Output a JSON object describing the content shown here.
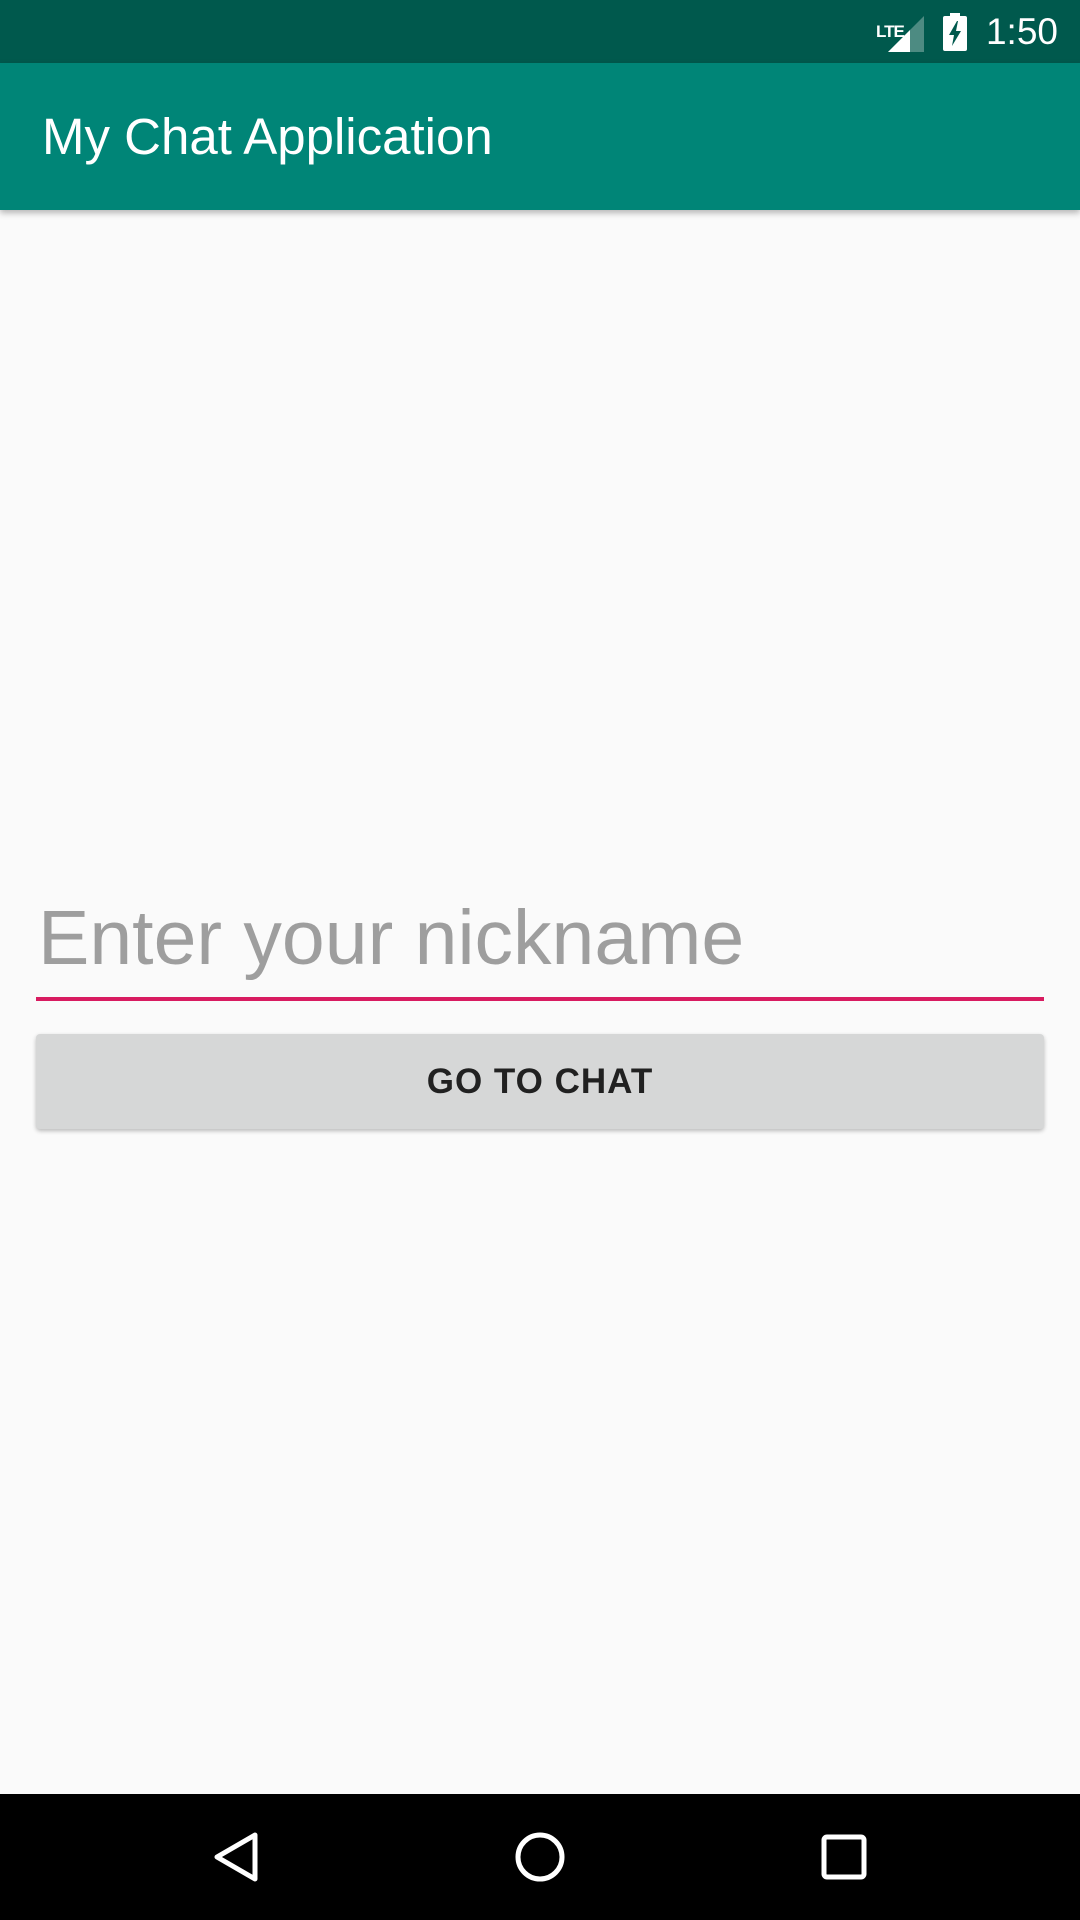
{
  "status_bar": {
    "network_label": "LTE",
    "time": "1:50",
    "icons": [
      "lte-signal-icon",
      "battery-charging-icon"
    ]
  },
  "app_bar": {
    "title": "My Chat Application"
  },
  "nickname": {
    "value": "",
    "placeholder": "Enter your nickname"
  },
  "go_button": {
    "label": "GO TO CHAT"
  },
  "nav_bar": {
    "icons": [
      "back-icon",
      "home-icon",
      "recents-icon"
    ]
  },
  "colors": {
    "status_bar": "#00594D",
    "app_bar": "#008577",
    "accent": "#D81B60",
    "background": "#FAFAFA",
    "button": "#D6D7D7",
    "nav_bar": "#000000"
  }
}
